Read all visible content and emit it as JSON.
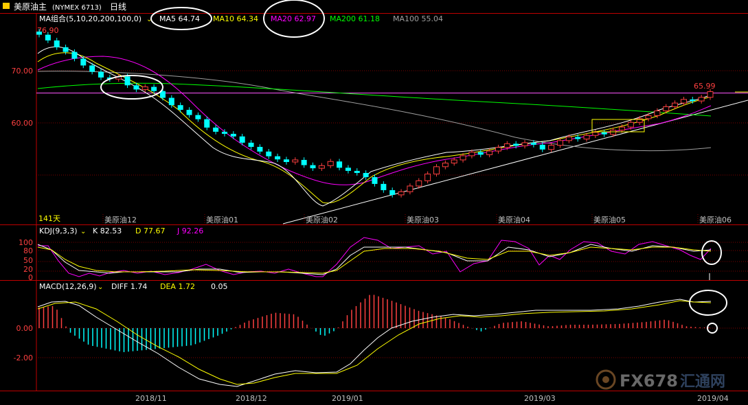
{
  "header": {
    "title": "美原油主",
    "code": "(NYMEX 6713)",
    "period": "日线"
  },
  "colors": {
    "background": "#000000",
    "up": "#ff4040",
    "down": "#00ffff",
    "ma5": "#ffffff",
    "ma10": "#ffff00",
    "ma20": "#ff00ff",
    "ma200": "#00ff00",
    "ma100": "#a0a0a0",
    "grid": "#800000",
    "axis": "#c00000",
    "hline": "#ff55ff"
  },
  "price_panel": {
    "indicator_label": "MA组合(5,10,20,200,100,0)",
    "legend": [
      {
        "name": "MA5",
        "value": "64.74",
        "color": "#ffffff"
      },
      {
        "name": "MA10",
        "value": "64.34",
        "color": "#ffff00"
      },
      {
        "name": "MA20",
        "value": "62.97",
        "color": "#ff00ff"
      },
      {
        "name": "MA200",
        "value": "61.18",
        "color": "#00ff00"
      },
      {
        "name": "MA100",
        "value": "55.04",
        "color": "#a0a0a0"
      }
    ],
    "high_label": "76.90",
    "last_label": "65.99",
    "days_label": "141天",
    "y_ticks": [
      "70.00",
      "60.00"
    ],
    "contract_labels": [
      "美原油12",
      "美原油01",
      "美原油02",
      "美原油03",
      "美原油04",
      "美原油05",
      "美原油06"
    ]
  },
  "kdj_panel": {
    "indicator_label": "KDJ(9,3,3)",
    "legend": [
      {
        "name": "K",
        "value": "82.53",
        "color": "#ffffff"
      },
      {
        "name": "D",
        "value": "77.67",
        "color": "#ffff00"
      },
      {
        "name": "J",
        "value": "92.26",
        "color": "#ff00ff"
      }
    ],
    "y_ticks": [
      "100",
      "80",
      "50",
      "20",
      "0"
    ]
  },
  "macd_panel": {
    "indicator_label": "MACD(12,26,9)",
    "legend": [
      {
        "name": "DIFF",
        "value": "1.74",
        "color": "#ffffff"
      },
      {
        "name": "DEA",
        "value": "1.72",
        "color": "#ffff00"
      },
      {
        "name": "",
        "value": "0.05",
        "color": "#ffffff"
      }
    ],
    "y_ticks": [
      "0.00",
      "-2.00"
    ]
  },
  "x_axis": {
    "labels": [
      "2018/11",
      "2018/12",
      "2019/01",
      "2019/03",
      "2019/04"
    ]
  },
  "watermark": {
    "text": "FX678",
    "text2": "汇通网"
  },
  "chart_data": [
    {
      "type": "candlestick",
      "title": "美原油主(NYMEX 6713) 日线",
      "x": [
        "2018/11",
        "2018/12",
        "2019/01",
        "2019/03",
        "2019/04"
      ],
      "ylim": [
        45,
        78
      ],
      "y_ticks": [
        70,
        60
      ],
      "close_path": [
        76.9,
        75.8,
        74.5,
        73.6,
        72.3,
        71.0,
        69.8,
        68.7,
        68.4,
        68.9,
        67.2,
        66.4,
        66.9,
        66.1,
        64.8,
        63.4,
        62.5,
        61.5,
        60.7,
        59.1,
        58.3,
        57.9,
        57.4,
        56.2,
        55.4,
        54.5,
        53.6,
        53.0,
        52.5,
        52.9,
        51.9,
        51.3,
        51.8,
        52.6,
        51.4,
        50.8,
        50.4,
        49.6,
        48.3,
        47.1,
        46.2,
        46.8,
        47.9,
        48.9,
        50.2,
        51.6,
        52.3,
        52.9,
        53.7,
        54.4,
        53.9,
        54.6,
        55.3,
        56.0,
        55.6,
        56.2,
        55.8,
        54.9,
        55.7,
        56.6,
        57.3,
        56.9,
        57.6,
        58.2,
        57.8,
        58.6,
        59.2,
        60.1,
        60.8,
        61.4,
        62.3,
        63.1,
        63.8,
        64.5,
        64.2,
        64.9,
        65.99
      ],
      "ma_values": {
        "MA5": 64.74,
        "MA10": 64.34,
        "MA20": 62.97,
        "MA200": 61.18,
        "MA100": 55.04
      },
      "high": 76.9,
      "last": 65.99,
      "horizontal_line": 65.99
    },
    {
      "type": "line",
      "title": "KDJ(9,3,3)",
      "ylim": [
        0,
        100
      ],
      "y_ticks": [
        100,
        80,
        50,
        20,
        0
      ],
      "series": [
        {
          "name": "K",
          "values": [
            82.53
          ]
        },
        {
          "name": "D",
          "values": [
            77.67
          ]
        },
        {
          "name": "J",
          "values": [
            92.26
          ]
        }
      ]
    },
    {
      "type": "bar",
      "title": "MACD(12,26,9)",
      "y_ticks": [
        0,
        -2
      ],
      "series": [
        {
          "name": "DIFF",
          "values": [
            1.74
          ]
        },
        {
          "name": "DEA",
          "values": [
            1.72
          ]
        }
      ],
      "histogram_last": 0.05
    }
  ]
}
